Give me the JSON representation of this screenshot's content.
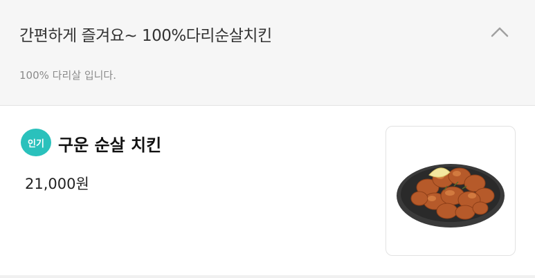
{
  "section": {
    "title": "간편하게 즐겨요~ 100%다리순살치킨",
    "description": "100% 다리살 입니다.",
    "collapse_icon": "chevron-up-icon"
  },
  "menu_item": {
    "badge": "인기",
    "badge_color": "#2ac1bc",
    "name": "구운 순살 치킨",
    "price": "21,000원",
    "image_icon": "chicken-photo"
  }
}
